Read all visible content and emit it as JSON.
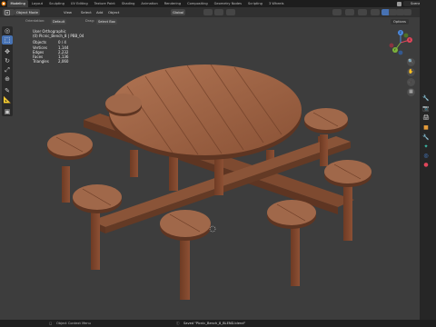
{
  "workspace_tabs": [
    "Modeling",
    "Layout",
    "Sculpting",
    "UV Editing",
    "Texture Paint",
    "Shading",
    "Animation",
    "Rendering",
    "Compositing",
    "Geometry Nodes",
    "Scripting",
    "3 Wheels"
  ],
  "active_tab_index": 0,
  "scene_name": "Scene",
  "header": {
    "mode": "Object Mode",
    "menus": [
      "View",
      "Select",
      "Add",
      "Object"
    ],
    "transform_orientation": "Global"
  },
  "subheader": {
    "orientation_label": "Orientation:",
    "orientation_value": "Default",
    "drag_label": "Drag:",
    "drag_value": "Select Box",
    "options_label": "Options"
  },
  "viewport_info": {
    "view_name": "User Orthographic",
    "object_name": "(0) Picnic_Bench_8 | PBB_04",
    "stats": [
      {
        "label": "Objects",
        "value": "0 / 4"
      },
      {
        "label": "Vertices",
        "value": "1,144"
      },
      {
        "label": "Edges",
        "value": "2,232"
      },
      {
        "label": "Faces",
        "value": "1,136"
      },
      {
        "label": "Triangles",
        "value": "2,060"
      }
    ]
  },
  "gizmo_axes": [
    "X",
    "Y",
    "Z"
  ],
  "status_bar": {
    "left_text": "Object Context Menu",
    "center_text": "Saved \"Picnic_Bench_8_BLEND.blend\""
  },
  "colors": {
    "accent": "#4772b3",
    "wood_light": "#a0684a",
    "wood_mid": "#8a5438",
    "wood_dark": "#5e3522",
    "viewport_bg": "#3d3d3d"
  }
}
